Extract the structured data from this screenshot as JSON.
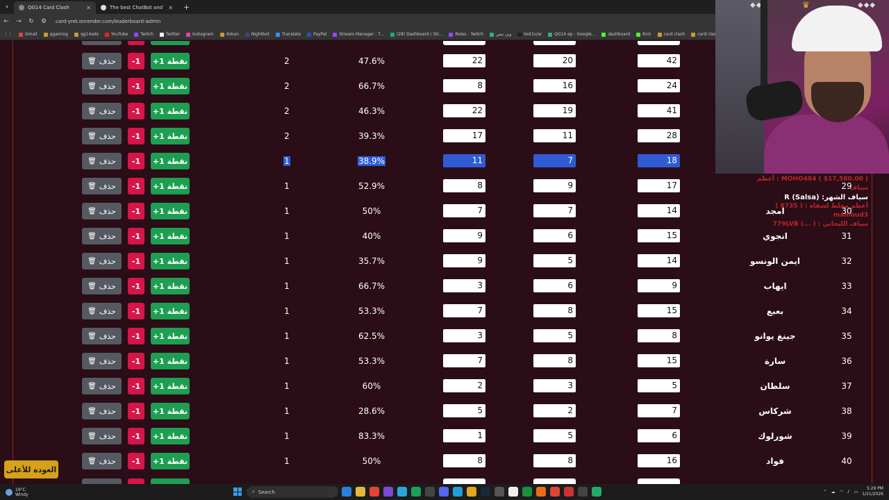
{
  "browser": {
    "tabs": [
      {
        "title": "QG14 Card Clash",
        "active": true
      },
      {
        "title": "The best ChatBot and Widget",
        "active": false
      }
    ],
    "url": "card-yret.onrender.com/leaderboard-admin",
    "bookmarks": [
      "Gmail",
      "qgaming",
      "qg14ads",
      "YouTube",
      "Twitch",
      "Twitter",
      "Instagram",
      "dokan",
      "Nightbot",
      "Translate",
      "PayPal",
      "Stream Manager - T...",
      "(28) Dashboard / Str...",
      "Roles - Twitch",
      "وين نيس",
      "tod.tv/ar",
      "QG14 ep - Google...",
      "dashboard",
      "Kick",
      "card clash",
      "card clash football"
    ]
  },
  "buttons": {
    "delete": "حذف",
    "minus": "-1",
    "plus": "+1 نقطة",
    "trash_icon": "🗑"
  },
  "rows": [
    {
      "rank": "",
      "name": "",
      "lvl": "2",
      "pct": "47.6%",
      "a": "22",
      "b": "20",
      "c": "42",
      "selected": false
    },
    {
      "rank": "",
      "name": "",
      "lvl": "2",
      "pct": "66.7%",
      "a": "8",
      "b": "16",
      "c": "24",
      "selected": false
    },
    {
      "rank": "",
      "name": "",
      "lvl": "2",
      "pct": "46.3%",
      "a": "22",
      "b": "19",
      "c": "41",
      "selected": false
    },
    {
      "rank": "",
      "name": "",
      "lvl": "2",
      "pct": "39.3%",
      "a": "17",
      "b": "11",
      "c": "28",
      "selected": false
    },
    {
      "rank": "",
      "name": "",
      "lvl": "1",
      "pct": "38.9%",
      "a": "11",
      "b": "7",
      "c": "18",
      "selected": true
    },
    {
      "rank": "29",
      "name": "",
      "lvl": "1",
      "pct": "52.9%",
      "a": "8",
      "b": "9",
      "c": "17",
      "selected": false
    },
    {
      "rank": "30",
      "name": "امجد",
      "lvl": "1",
      "pct": "50%",
      "a": "7",
      "b": "7",
      "c": "14",
      "selected": false
    },
    {
      "rank": "31",
      "name": "انجوي",
      "lvl": "1",
      "pct": "40%",
      "a": "9",
      "b": "6",
      "c": "15",
      "selected": false
    },
    {
      "rank": "32",
      "name": "ايمن الونسو",
      "lvl": "1",
      "pct": "35.7%",
      "a": "9",
      "b": "5",
      "c": "14",
      "selected": false
    },
    {
      "rank": "33",
      "name": "ايهاب",
      "lvl": "1",
      "pct": "66.7%",
      "a": "3",
      "b": "6",
      "c": "9",
      "selected": false
    },
    {
      "rank": "34",
      "name": "بعبع",
      "lvl": "1",
      "pct": "53.3%",
      "a": "7",
      "b": "8",
      "c": "15",
      "selected": false
    },
    {
      "rank": "35",
      "name": "جينغ يوانو",
      "lvl": "1",
      "pct": "62.5%",
      "a": "3",
      "b": "5",
      "c": "8",
      "selected": false
    },
    {
      "rank": "36",
      "name": "سارة",
      "lvl": "1",
      "pct": "53.3%",
      "a": "7",
      "b": "8",
      "c": "15",
      "selected": false
    },
    {
      "rank": "37",
      "name": "سلطان",
      "lvl": "1",
      "pct": "60%",
      "a": "2",
      "b": "3",
      "c": "5",
      "selected": false
    },
    {
      "rank": "38",
      "name": "شركاس",
      "lvl": "1",
      "pct": "28.6%",
      "a": "5",
      "b": "2",
      "c": "7",
      "selected": false
    },
    {
      "rank": "39",
      "name": "شورلوك",
      "lvl": "1",
      "pct": "83.3%",
      "a": "1",
      "b": "5",
      "c": "6",
      "selected": false
    },
    {
      "rank": "40",
      "name": "فواد",
      "lvl": "1",
      "pct": "50%",
      "a": "8",
      "b": "8",
      "c": "16",
      "selected": false
    }
  ],
  "overlay": {
    "line1": "MOHO484 ( $17,580.00 ) : أعظم سياف",
    "line2": "سياف الشهر: (Salsa) R",
    "line3": "أعظم مخلط لشفاة : ( 6735 ) mamoud3",
    "line4": "سياف الليخاني : ( ...) 779LVB"
  },
  "back_to_top": "العودة للأعلى",
  "taskbar": {
    "weather_temp": "19°C",
    "weather_desc": "Windy",
    "search_placeholder": "Search",
    "time": "5:29 PM",
    "date": "1/21/2026"
  }
}
